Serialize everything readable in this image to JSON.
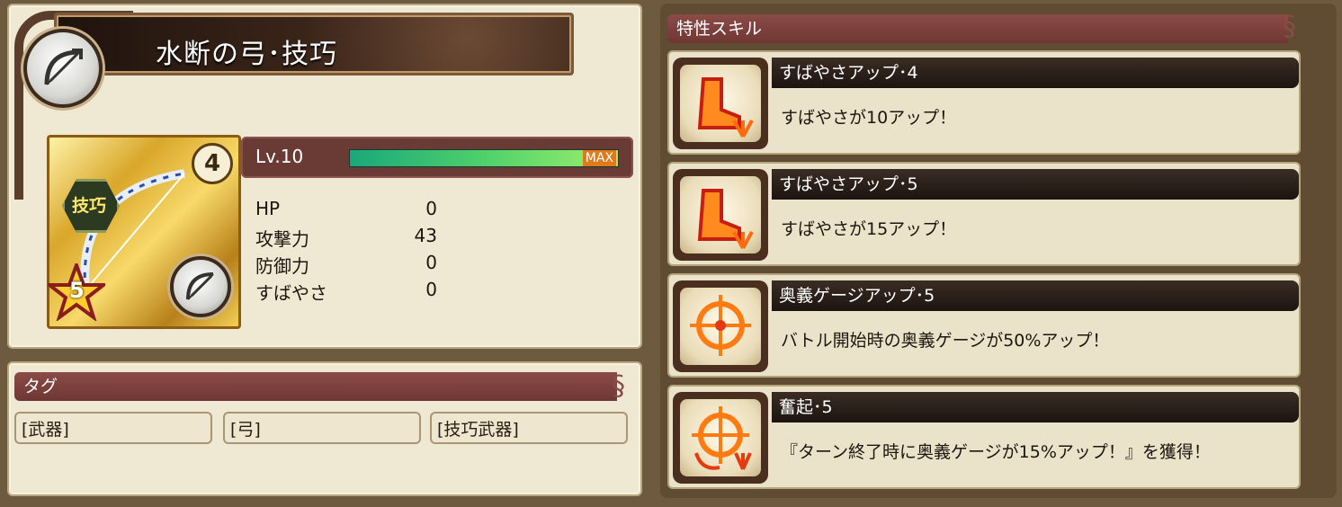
{
  "weapon": {
    "name": "水断の弓･技巧",
    "rarity_stars": "5",
    "limit_break": "4",
    "type_badge": "技巧"
  },
  "level": {
    "label": "Lv.10",
    "max_label": "MAX",
    "progress": 1.0
  },
  "stats": [
    {
      "label": "HP",
      "value": "0"
    },
    {
      "label": "攻撃力",
      "value": "43"
    },
    {
      "label": "防御力",
      "value": "0"
    },
    {
      "label": "すばやさ",
      "value": "0"
    }
  ],
  "tags": {
    "header": "タグ",
    "items": [
      "[武器]",
      "[弓]",
      "[技巧武器]"
    ]
  },
  "skills": {
    "header": "特性スキル",
    "items": [
      {
        "name": "すばやさアップ･4",
        "desc": "すばやさが10アップ！",
        "icon": "boot-icon"
      },
      {
        "name": "すばやさアップ･5",
        "desc": "すばやさが15アップ！",
        "icon": "boot-icon"
      },
      {
        "name": "奥義ゲージアップ･5",
        "desc": "バトル開始時の奥義ゲージが50%アップ！",
        "icon": "ougi-gauge-icon"
      },
      {
        "name": "奮起･5",
        "desc": "『ターン終了時に奥義ゲージが15%アップ！』を獲得！",
        "icon": "ougi-rising-icon"
      }
    ]
  },
  "colors": {
    "panel_bg": "#efe8d2",
    "header_red": "#7a3f3b",
    "gauge_green": "#4fd06c"
  }
}
